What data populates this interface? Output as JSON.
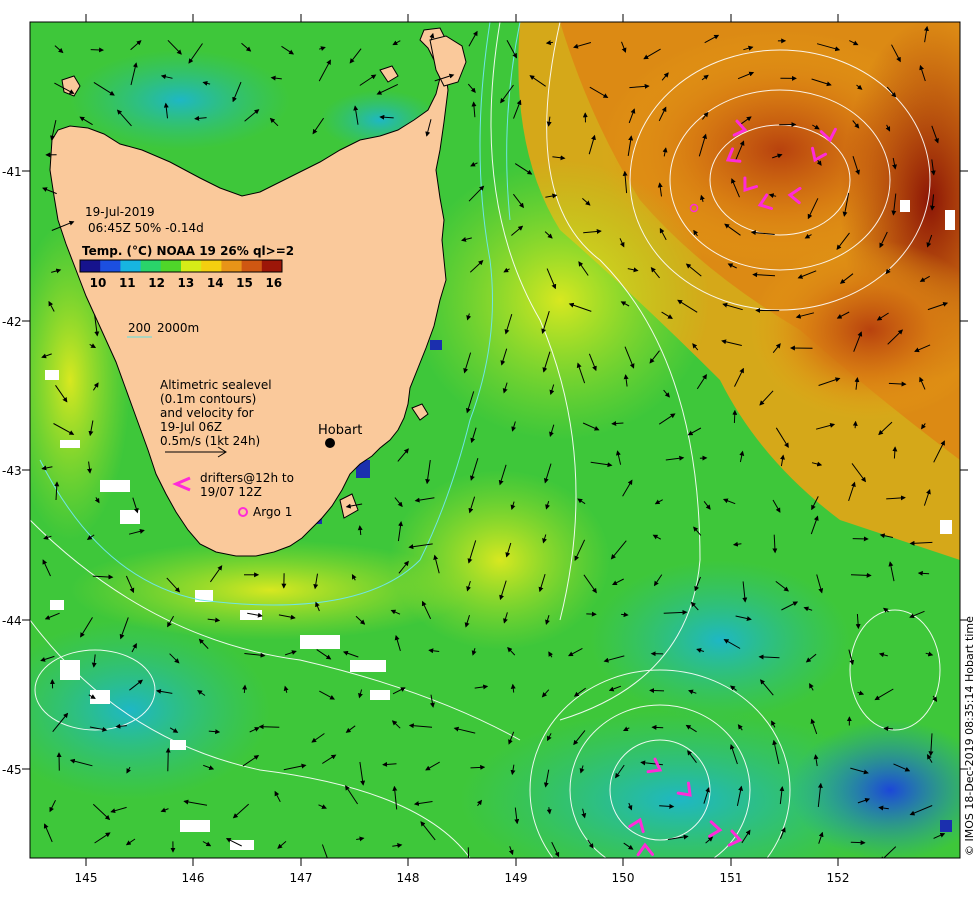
{
  "map": {
    "date": "19-Jul-2019",
    "time_info": "06:45Z  50% -0.14d",
    "colorbar_title": "Temp. (°C) NOAA 19 26% ql>=2",
    "colorbar_ticks": [
      "10",
      "11",
      "12",
      "13",
      "14",
      "15",
      "16"
    ],
    "colorbar_colors": [
      "#16138d",
      "#1c4fe0",
      "#17b5e0",
      "#2ad46a",
      "#4fd62a",
      "#d6ec18",
      "#f4cf10",
      "#e89418",
      "#cf5712",
      "#9c1608"
    ],
    "contour_legend": {
      "label_200": "200",
      "label_2000": "2000m",
      "color": "#5fe0e0"
    },
    "sealevel_note": [
      "Altimetric sealevel",
      "(0.1m contours)",
      "and velocity for",
      "19-Jul 06Z",
      "0.5m/s (1kt 24h)"
    ],
    "drifters_note": [
      "drifters@12h to",
      "19/07 12Z"
    ],
    "argo_label": "Argo 1",
    "city_label": "Hobart",
    "x_ticks": [
      "145",
      "146",
      "147",
      "148",
      "149",
      "150",
      "151",
      "152"
    ],
    "y_ticks": [
      "-41",
      "-42",
      "-43",
      "-44",
      "-45"
    ],
    "credit": "© IMOS 18-Dec-2019 08:35:14 Hobart time",
    "colors": {
      "land": "#fac99b",
      "sea_green": "#3dc83a",
      "sea_warm": "#e0a020",
      "sea_cool": "#1fb0c8",
      "drifter": "#ff2bd8",
      "contour": "#ffffff"
    }
  }
}
